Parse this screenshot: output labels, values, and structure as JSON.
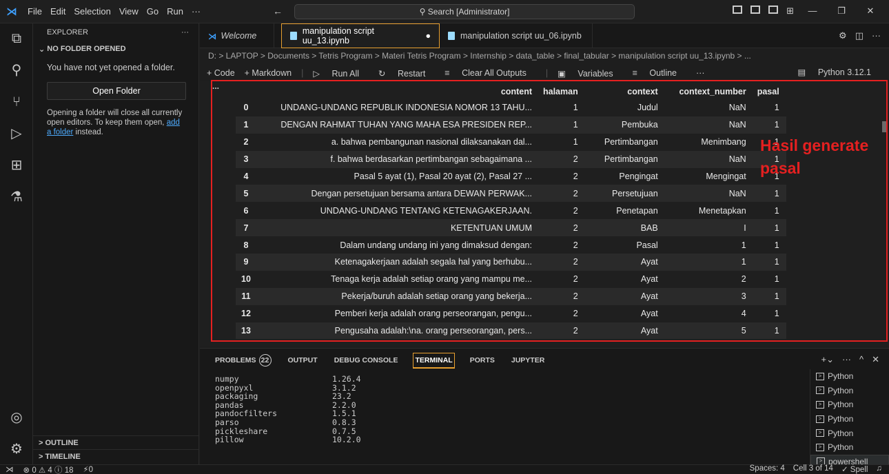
{
  "menu": [
    "File",
    "Edit",
    "Selection",
    "View",
    "Go",
    "Run",
    "···"
  ],
  "search": {
    "placeholder": "Search [Administrator]"
  },
  "nav": "← →",
  "sidebar": {
    "title": "EXPLORER",
    "section": "NO FOLDER OPENED",
    "message": "You have not yet opened a folder.",
    "open_button": "Open Folder",
    "hint_before": "Opening a folder will close all currently open editors. To keep them open, ",
    "hint_link": "add a folder",
    "hint_after": " instead.",
    "outline": "OUTLINE",
    "timeline": "TIMELINE"
  },
  "tabs": [
    {
      "label": "Welcome"
    },
    {
      "label": "manipulation script uu_13.ipynb"
    },
    {
      "label": "manipulation script uu_06.ipynb"
    }
  ],
  "breadcrumb": "D: > LAPTOP > Documents > Tetris Program > Materi Tetris Program > Internship > data_table > final_tabular > manipulation script uu_13.ipynb > ...",
  "toolbar": {
    "code": "+ Code",
    "markdown": "+ Markdown",
    "run_all": "Run All",
    "restart": "Restart",
    "clear": "Clear All Outputs",
    "variables": "Variables",
    "outline": "Outline",
    "more": "···",
    "kernel": "Python 3.12.1"
  },
  "output": {
    "ellipsis": "...",
    "columns": [
      "content",
      "halaman",
      "context",
      "context_number",
      "pasal"
    ],
    "rows": [
      [
        "0",
        "UNDANG-UNDANG REPUBLIK INDONESIA NOMOR 13 TAHU...",
        "1",
        "Judul",
        "NaN",
        "1"
      ],
      [
        "1",
        "DENGAN RAHMAT TUHAN YANG MAHA ESA PRESIDEN REP...",
        "1",
        "Pembuka",
        "NaN",
        "1"
      ],
      [
        "2",
        "a. bahwa pembangunan nasional dilaksanakan dal...",
        "1",
        "Pertimbangan",
        "Menimbang",
        "1"
      ],
      [
        "3",
        "f. bahwa berdasarkan pertimbangan sebagaimana ...",
        "2",
        "Pertimbangan",
        "NaN",
        "1"
      ],
      [
        "4",
        "Pasal 5 ayat (1), Pasal 20 ayat (2), Pasal 27 ...",
        "2",
        "Pengingat",
        "Mengingat",
        "1"
      ],
      [
        "5",
        "Dengan persetujuan bersama antara DEWAN PERWAK...",
        "2",
        "Persetujuan",
        "NaN",
        "1"
      ],
      [
        "6",
        "UNDANG-UNDANG TENTANG KETENAGAKERJAAN.",
        "2",
        "Penetapan",
        "Menetapkan",
        "1"
      ],
      [
        "7",
        "KETENTUAN UMUM",
        "2",
        "BAB",
        "I",
        "1"
      ],
      [
        "8",
        "Dalam undang undang ini yang dimaksud dengan:",
        "2",
        "Pasal",
        "1",
        "1"
      ],
      [
        "9",
        "Ketenagakerjaan adalah segala hal yang berhubu...",
        "2",
        "Ayat",
        "1",
        "1"
      ],
      [
        "10",
        "Tenaga kerja adalah setiap orang yang mampu me...",
        "2",
        "Ayat",
        "2",
        "1"
      ],
      [
        "11",
        "Pekerja/buruh adalah setiap orang yang bekerja...",
        "2",
        "Ayat",
        "3",
        "1"
      ],
      [
        "12",
        "Pemberi kerja adalah orang perseorangan, pengu...",
        "2",
        "Ayat",
        "4",
        "1"
      ],
      [
        "13",
        "Pengusaha adalah:\\na. orang perseorangan, pers...",
        "2",
        "Ayat",
        "5",
        "1"
      ]
    ],
    "annotation": "Hasil generate pasal"
  },
  "panel": {
    "tabs": [
      "PROBLEMS",
      "OUTPUT",
      "DEBUG CONSOLE",
      "TERMINAL",
      "PORTS",
      "JUPYTER"
    ],
    "problems_count": "22",
    "terminal_lines": [
      [
        "numpy",
        "1.26.4"
      ],
      [
        "openpyxl",
        "3.1.2"
      ],
      [
        "packaging",
        "23.2"
      ],
      [
        "pandas",
        "2.2.0"
      ],
      [
        "pandocfilters",
        "1.5.1"
      ],
      [
        "parso",
        "0.8.3"
      ],
      [
        "pickleshare",
        "0.7.5"
      ],
      [
        "pillow",
        "10.2.0"
      ]
    ],
    "terminals": [
      "Python",
      "Python",
      "Python",
      "Python",
      "Python",
      "Python",
      "powershell"
    ]
  },
  "status": {
    "left": "⊗ 0 ⚠ 4 ⓘ 18",
    "ports": "0",
    "spaces": "Spaces: 4",
    "cell": "Cell 3 of 14",
    "spell": "✓ Spell"
  }
}
